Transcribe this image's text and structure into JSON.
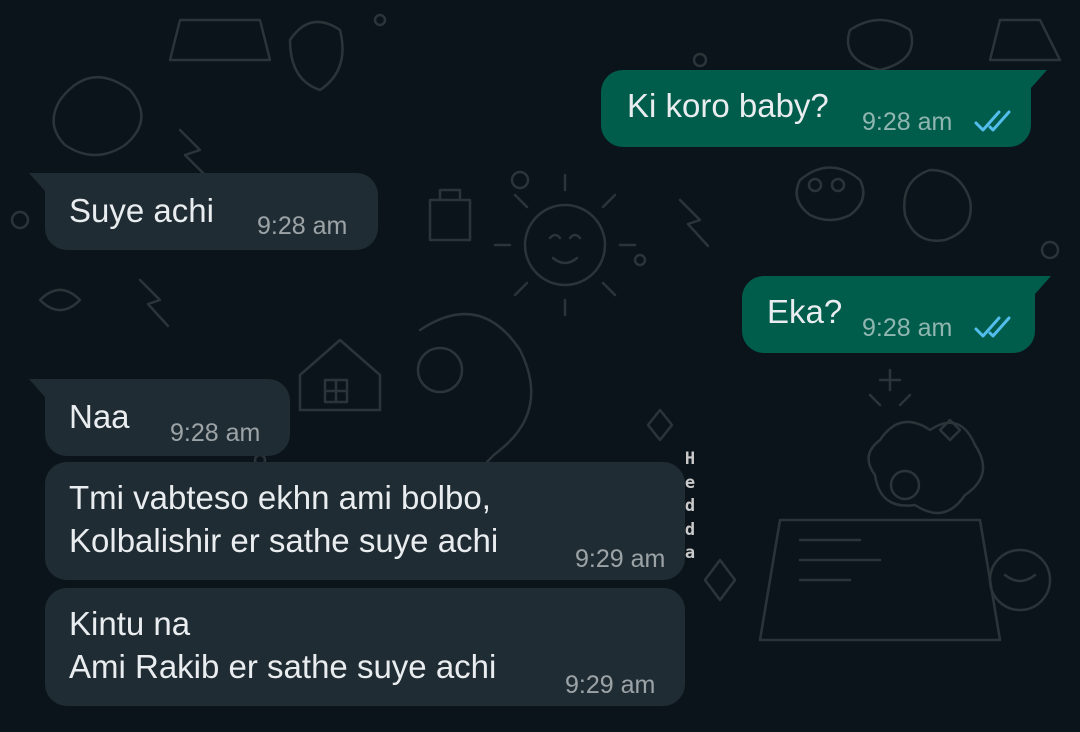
{
  "messages": [
    {
      "direction": "outgoing",
      "text": "Ki koro baby?",
      "time": "9:28 am",
      "status_icon": "double-check-read-icon"
    },
    {
      "direction": "incoming",
      "text": "Suye achi",
      "time": "9:28 am"
    },
    {
      "direction": "outgoing",
      "text": "Eka?",
      "time": "9:28 am",
      "status_icon": "double-check-read-icon"
    },
    {
      "direction": "incoming",
      "text": "Naa",
      "time": "9:28 am"
    },
    {
      "direction": "incoming",
      "lines": [
        "Tmi vabteso ekhn ami bolbo,",
        "Kolbalishir er sathe suye achi"
      ],
      "time": "9:29 am"
    },
    {
      "direction": "incoming",
      "lines": [
        "Kintu na",
        "Ami Rakib er sathe suye achi"
      ],
      "time": "9:29 am"
    }
  ],
  "watermark": [
    "H",
    "e",
    "d",
    "d",
    "a"
  ],
  "colors": {
    "background": "#0b141a",
    "outgoing_bubble": "#005c4b",
    "incoming_bubble": "#202c33",
    "read_ticks": "#53bdeb"
  }
}
